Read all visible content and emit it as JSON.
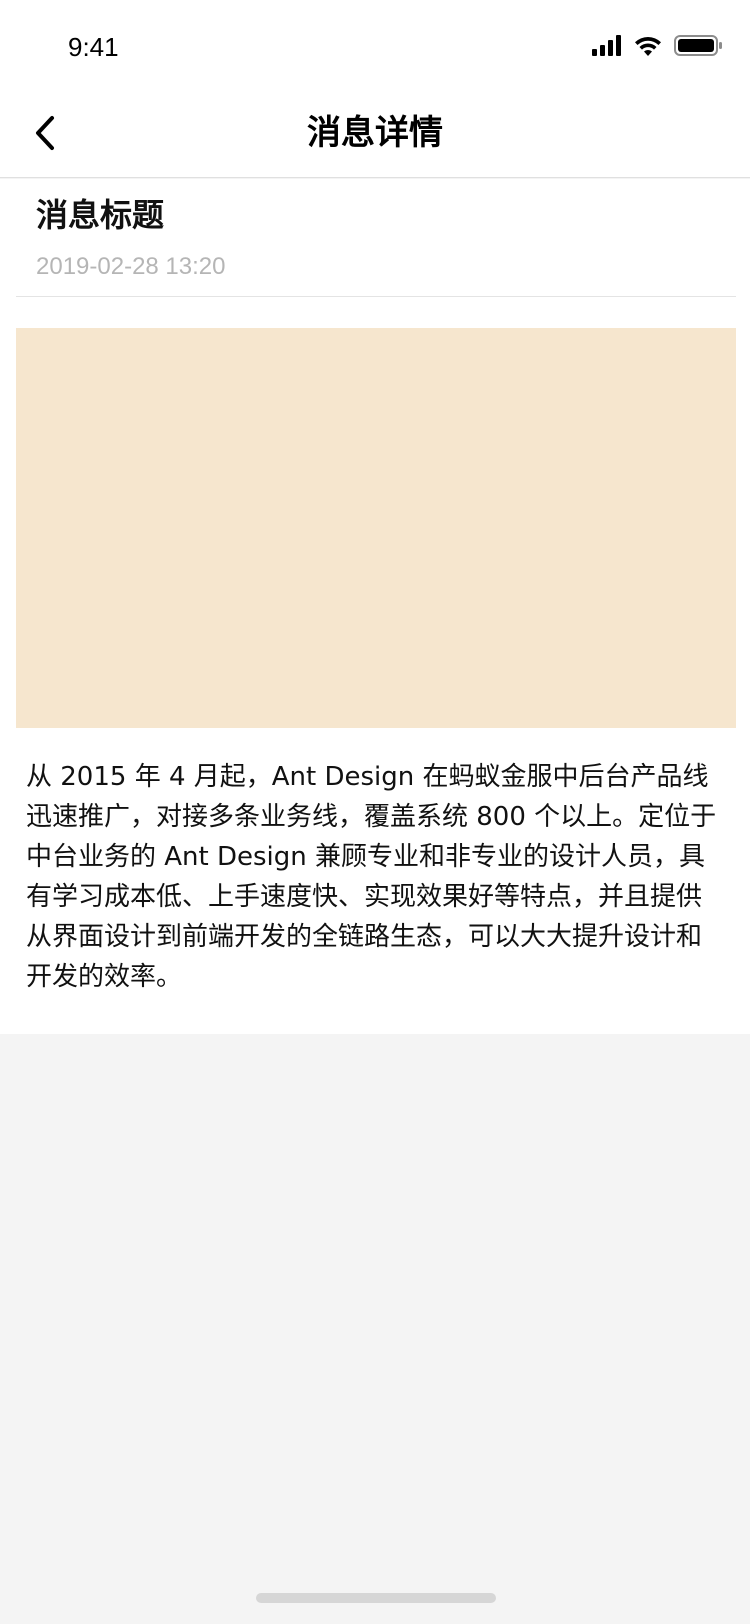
{
  "status_bar": {
    "time": "9:41",
    "icons": [
      "signal-icon",
      "wifi-icon",
      "battery-icon"
    ]
  },
  "nav": {
    "title": "消息详情",
    "back_icon": "chevron-left-icon"
  },
  "message": {
    "title": "消息标题",
    "date": "2019-02-28 13:20",
    "body": "从 2015 年 4 月起，Ant Design 在蚂蚁金服中后台产品线迅速推广，对接多条业务线，覆盖系统 800 个以上。定位于中台业务的 Ant Design 兼顾专业和非专业的设计人员，具有学习成本低、上手速度快、实现效果好等特点，并且提供从界面设计到前端开发的全链路生态，可以大大提升设计和开发的效率。"
  },
  "colors": {
    "cover_placeholder": "#f6e6ce",
    "page_background": "#f4f4f4",
    "date_text": "#b5b5b5"
  }
}
